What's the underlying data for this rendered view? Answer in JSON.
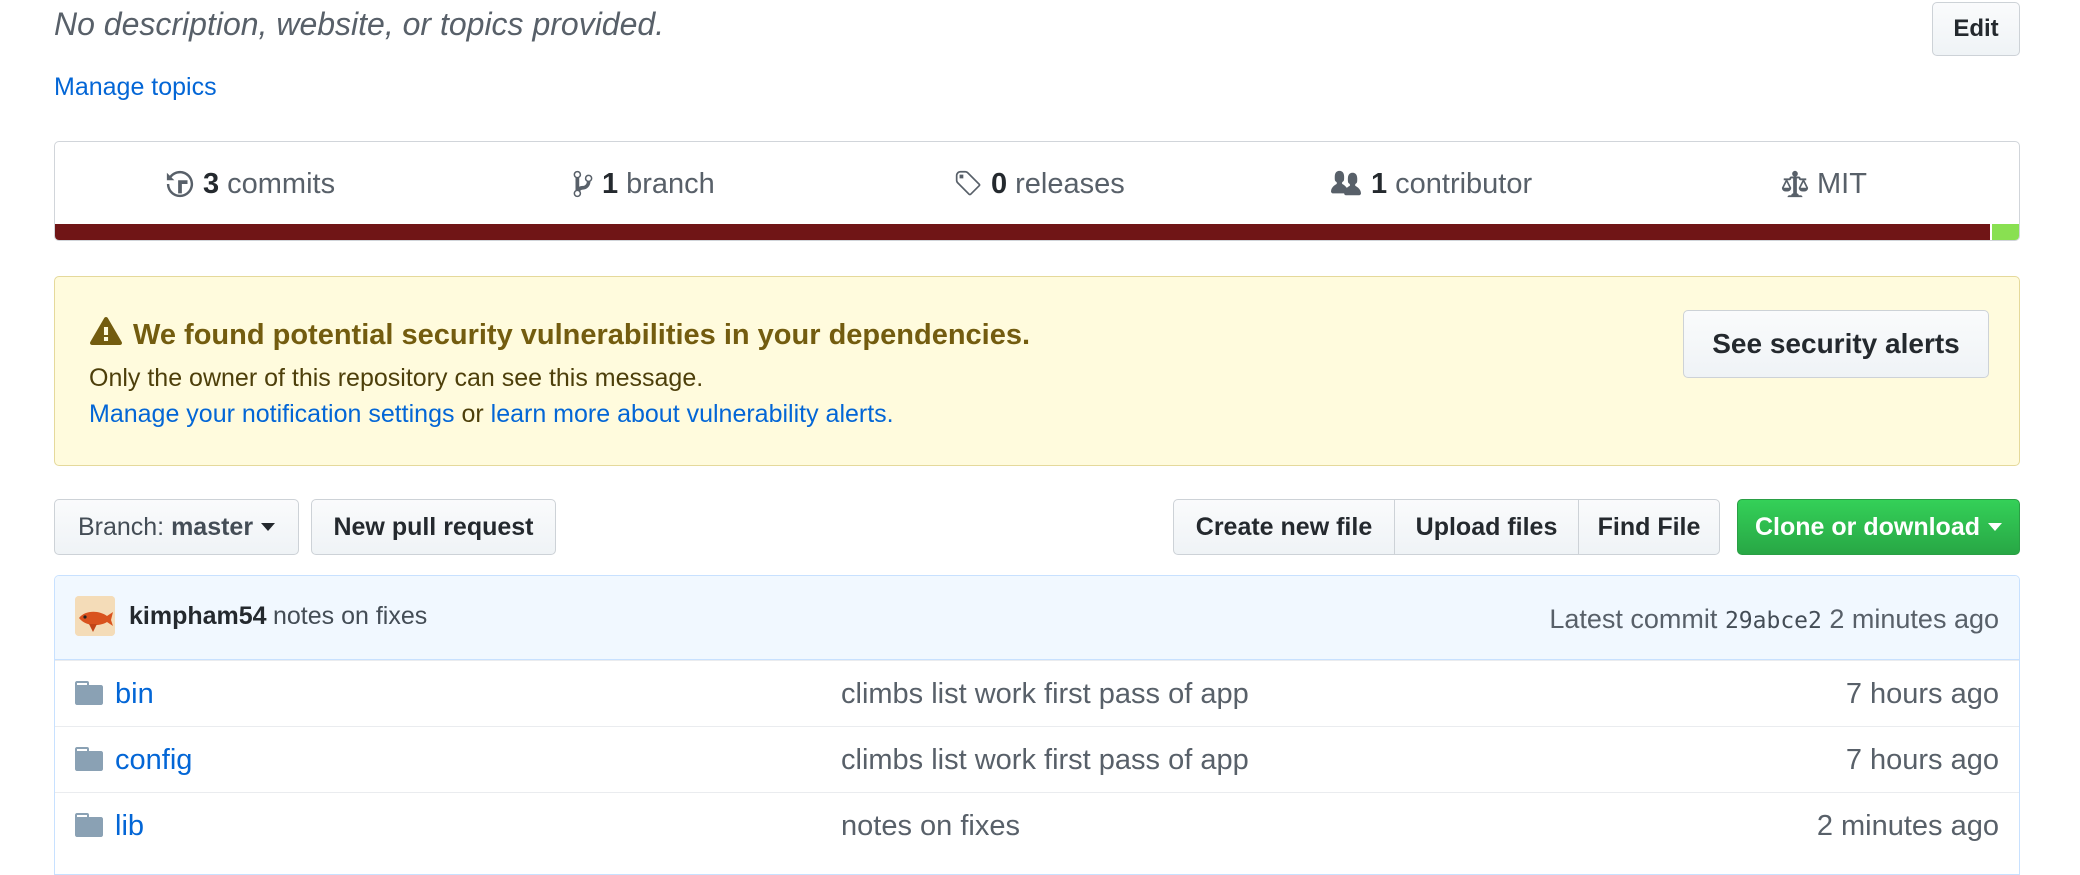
{
  "repo": {
    "description": "No description, website, or topics provided.",
    "edit_label": "Edit",
    "manage_topics": "Manage topics"
  },
  "summary": {
    "commits": {
      "count": "3",
      "label": "commits"
    },
    "branches": {
      "count": "1",
      "label": "branch"
    },
    "releases": {
      "count": "0",
      "label": "releases"
    },
    "contributors": {
      "count": "1",
      "label": "contributor"
    },
    "license": "MIT",
    "languages": [
      {
        "color": "#701516",
        "share": 0.986
      },
      {
        "color": "#89e051",
        "share": 0.014
      }
    ]
  },
  "alert": {
    "title": "We found potential security vulnerabilities in your dependencies.",
    "owner_note": "Only the owner of this repository can see this message.",
    "manage_link": "Manage your notification settings",
    "or_text": "or",
    "learn_link": "learn more about vulnerability alerts.",
    "button_label": "See security alerts"
  },
  "file_nav": {
    "branch_prefix": "Branch:",
    "branch_name": "master",
    "new_pr": "New pull request",
    "create_file": "Create new file",
    "upload_files": "Upload files",
    "find_file": "Find File",
    "clone": "Clone or download"
  },
  "latest_commit": {
    "author": "kimpham54",
    "message": "notes on fixes",
    "label": "Latest commit",
    "sha": "29abce2",
    "age": "2 minutes ago"
  },
  "files": [
    {
      "name": "bin",
      "message": "climbs list work first pass of app",
      "age": "7 hours ago",
      "icon": "folder-icon"
    },
    {
      "name": "config",
      "message": "climbs list work first pass of app",
      "age": "7 hours ago",
      "icon": "folder-icon"
    },
    {
      "name": "lib",
      "message": "notes on fixes",
      "age": "2 minutes ago",
      "icon": "folder-icon"
    }
  ],
  "colors": {
    "link": "#0366d6",
    "alert_bg": "#fffbdd",
    "clone_green": "#28a745"
  }
}
